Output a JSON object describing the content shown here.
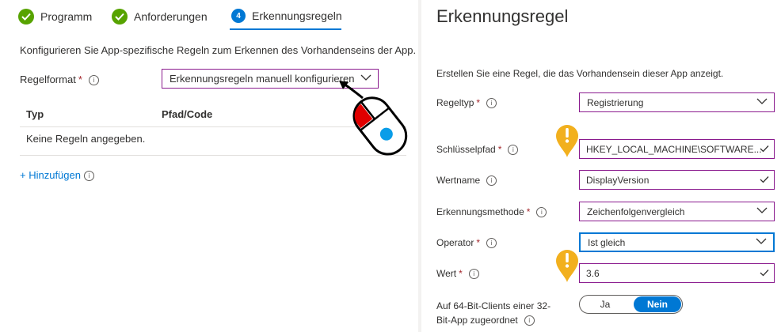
{
  "steps": [
    {
      "label": "Programm",
      "state": "done"
    },
    {
      "label": "Anforderungen",
      "state": "done"
    },
    {
      "label": "Erkennungsregeln",
      "state": "active",
      "number": "4"
    }
  ],
  "left": {
    "description": "Konfigurieren Sie App-spezifische Regeln zum Erkennen des Vorhandenseins der App.",
    "rule_format_label": "Regelformat",
    "rule_format_value": "Erkennungsregeln manuell konfigurieren",
    "table": {
      "columns": [
        "Typ",
        "Pfad/Code"
      ],
      "empty_text": "Keine Regeln angegeben."
    },
    "add_link": "+ Hinzufügen"
  },
  "right": {
    "title": "Erkennungsregel",
    "description": "Erstellen Sie eine Regel, die das Vorhandensein dieser App anzeigt.",
    "fields": {
      "rule_type": {
        "label": "Regeltyp",
        "value": "Registrierung"
      },
      "key_path": {
        "label": "Schlüsselpfad",
        "value": "HKEY_LOCAL_MACHINE\\SOFTWARE..."
      },
      "value_name": {
        "label": "Wertname",
        "value": "DisplayVersion"
      },
      "detection_method": {
        "label": "Erkennungsmethode",
        "value": "Zeichenfolgenvergleich"
      },
      "operator": {
        "label": "Operator",
        "value": "Ist gleich"
      },
      "value": {
        "label": "Wert",
        "value": "3.6"
      }
    },
    "bit_label_line1": "Auf 64-Bit-Clients einer 32-",
    "bit_label_line2": "Bit-App zugeordnet",
    "toggle": {
      "on_label": "Ja",
      "off_label": "Nein",
      "selected": "Nein"
    }
  },
  "required_marker": "*",
  "info_glyph": "i",
  "colors": {
    "accent": "#0078d4",
    "success": "#57a300",
    "field_border": "#8a1a8e",
    "required": "#a4262c",
    "warning_pin": "#f2b01e"
  },
  "icons": {
    "step_done": "checkmark-circle-icon",
    "info": "info-icon",
    "chevron": "chevron-down-icon",
    "valid": "checkmark-icon",
    "warning": "warning-pin-icon",
    "mouse": "mouse-click-icon"
  }
}
